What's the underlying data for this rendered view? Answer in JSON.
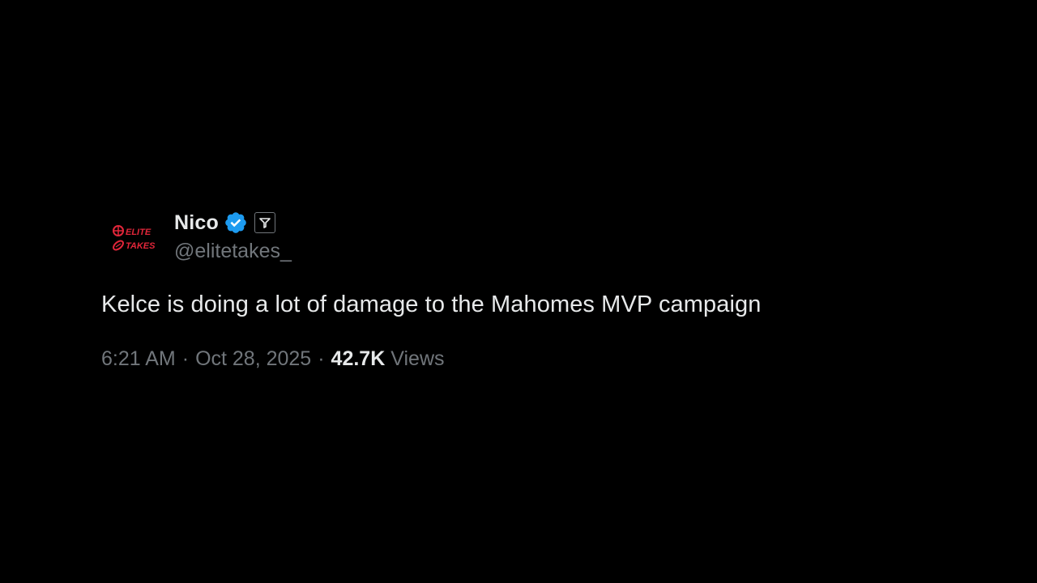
{
  "tweet": {
    "author": {
      "display_name": "Nico",
      "handle": "@elitetakes_",
      "verified": true,
      "avatar_logo_line1": "ELITE",
      "avatar_logo_line2": "TAKES"
    },
    "text": "Kelce is doing a lot of damage to the Mahomes MVP campaign",
    "time": "6:21 AM",
    "date": "Oct 28, 2025",
    "separator": "·",
    "views_count": "42.7K",
    "views_label": "Views"
  },
  "colors": {
    "background": "#000000",
    "primary_text": "#e7e9ea",
    "secondary_text": "#71767b",
    "verified_blue": "#1d9bf0",
    "logo_red": "#e2263a"
  },
  "icons": {
    "verified": "verified-badge-icon",
    "affiliate": "affiliate-badge-icon",
    "avatar": "elite-takes-logo"
  }
}
